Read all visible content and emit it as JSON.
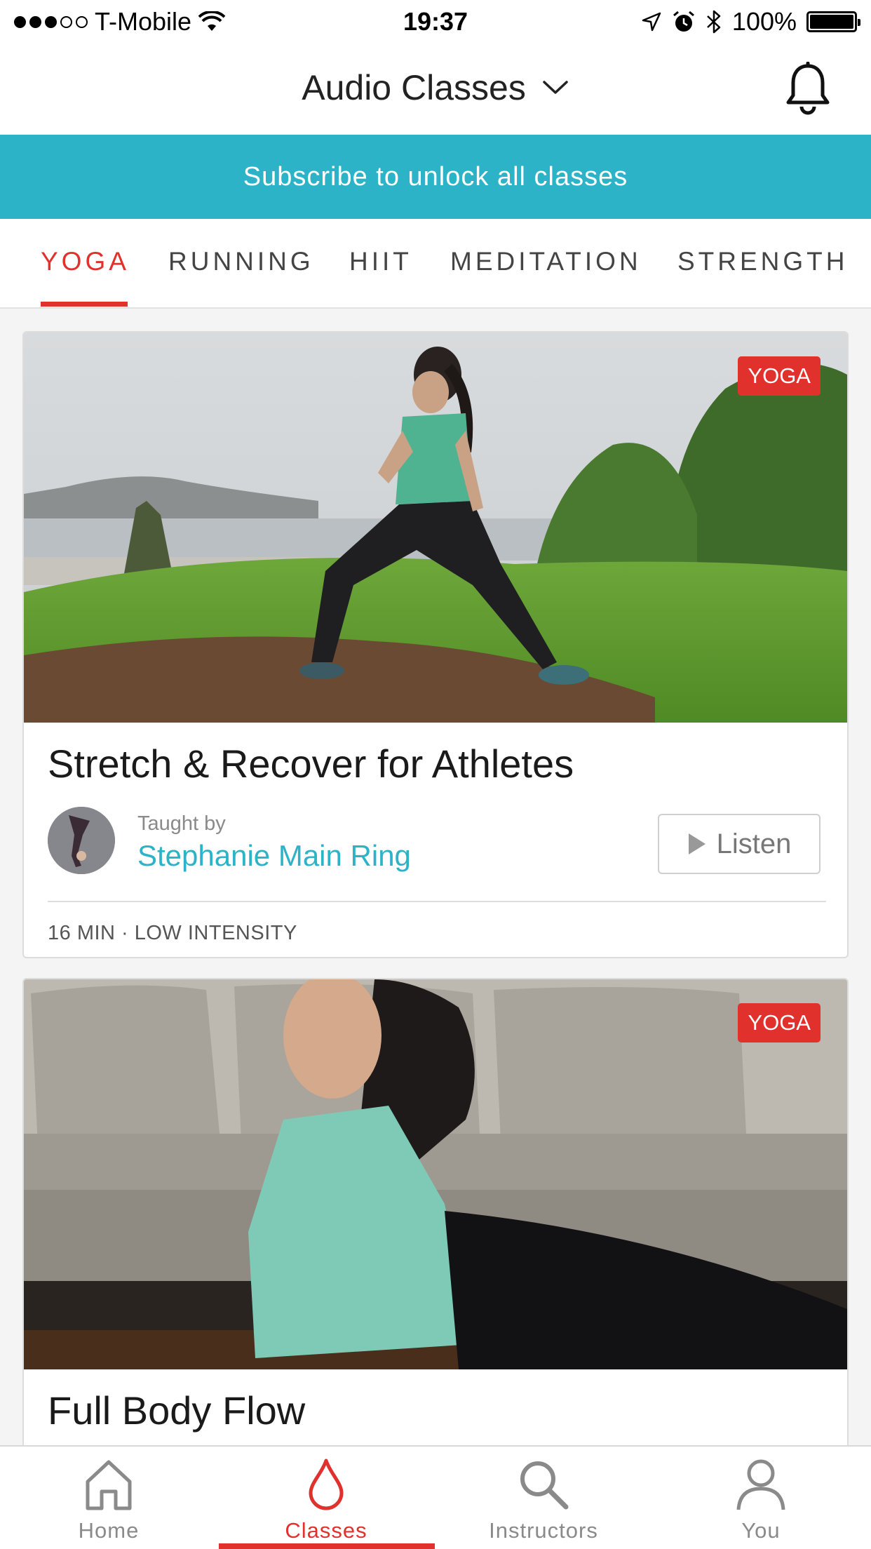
{
  "status_bar": {
    "carrier": "T-Mobile",
    "signal_dots_filled": 3,
    "signal_dots_total": 5,
    "time": "19:37",
    "battery": "100%"
  },
  "header": {
    "title": "Audio Classes",
    "icons": [
      "chevron-down-icon",
      "bell-icon"
    ]
  },
  "banner": {
    "text": "Subscribe to unlock all classes"
  },
  "tabs": [
    {
      "label": "YOGA",
      "active": true
    },
    {
      "label": "RUNNING",
      "active": false
    },
    {
      "label": "HIIT",
      "active": false
    },
    {
      "label": "MEDITATION",
      "active": false
    },
    {
      "label": "STRENGTH",
      "active": false
    }
  ],
  "cards": [
    {
      "badge": "YOGA",
      "title": "Stretch & Recover for Athletes",
      "taught_by_label": "Taught by",
      "instructor": "Stephanie Main Ring",
      "listen_label": "Listen",
      "meta": "16 MIN · LOW INTENSITY"
    },
    {
      "badge": "YOGA",
      "title": "Full Body Flow"
    }
  ],
  "tabbar": [
    {
      "label": "Home",
      "icon": "home-icon",
      "active": false
    },
    {
      "label": "Classes",
      "icon": "drop-icon",
      "active": true
    },
    {
      "label": "Instructors",
      "icon": "search-icon",
      "active": false
    },
    {
      "label": "You",
      "icon": "person-icon",
      "active": false
    }
  ],
  "colors": {
    "accent_red": "#e0312c",
    "teal": "#2db3c7",
    "text_gray": "#8a8a8a"
  }
}
